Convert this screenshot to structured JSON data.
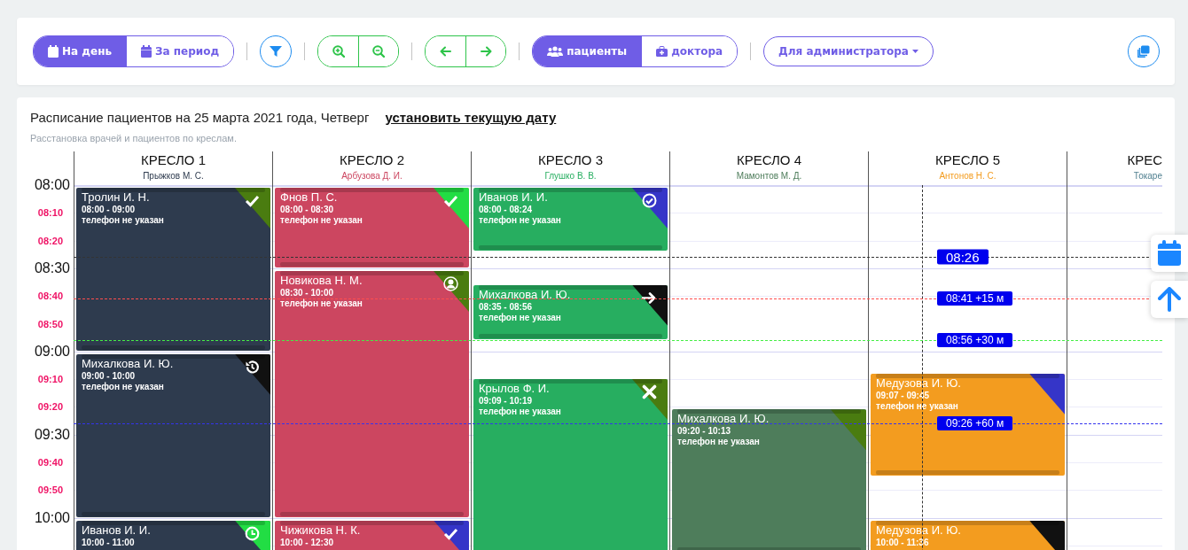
{
  "toolbar": {
    "view_toggle": [
      {
        "label": "На день",
        "selected": true
      },
      {
        "label": "За период",
        "selected": false
      }
    ],
    "mode_toggle": [
      {
        "label": "пациенты",
        "selected": true
      },
      {
        "label": "доктора",
        "selected": false
      }
    ],
    "role_dropdown": {
      "label": "Для администратора"
    }
  },
  "schedule": {
    "title": "Расписание пациентов на 25 марта 2021 года, Четверг",
    "set_today_link": "установить текущую дату",
    "subtitle": "Расстановка врачей и пациентов по креслам."
  },
  "time_labels": [
    {
      "label": "08:00",
      "kind": "hour"
    },
    {
      "label": "08:10",
      "kind": "minute"
    },
    {
      "label": "08:20",
      "kind": "minute"
    },
    {
      "label": "08:30",
      "kind": "hour"
    },
    {
      "label": "08:40",
      "kind": "minute"
    },
    {
      "label": "08:50",
      "kind": "minute"
    },
    {
      "label": "09:00",
      "kind": "hour"
    },
    {
      "label": "09:10",
      "kind": "minute"
    },
    {
      "label": "09:20",
      "kind": "minute"
    },
    {
      "label": "09:30",
      "kind": "hour"
    },
    {
      "label": "09:40",
      "kind": "minute"
    },
    {
      "label": "09:50",
      "kind": "minute"
    },
    {
      "label": "10:00",
      "kind": "hour"
    }
  ],
  "chairs": [
    {
      "name": "КРЕСЛО 1",
      "doctor": "Прыжков М. С.",
      "color": "#2e3b4e",
      "appointments": [
        {
          "patient": "Тролин И. Н.",
          "time": "08:00 - 09:00",
          "phone": "телефон не указан",
          "kind": "check",
          "color": "#4a7c10"
        },
        {
          "patient": "Михалкова И. Ю.",
          "time": "09:00 - 10:00",
          "phone": "телефон не указан",
          "kind": "history",
          "color": "#111111"
        },
        {
          "patient": "Иванов И. И.",
          "time": "10:00 - 11:00",
          "kind": "clock",
          "color": "#22dd44"
        }
      ]
    },
    {
      "name": "КРЕСЛО 2",
      "doctor": "Арбузова Д. И.",
      "color": "#cc4660",
      "appointments": [
        {
          "patient": "Фнов П. С.",
          "time": "08:00 - 08:30",
          "phone": "телефон не указан",
          "kind": "check",
          "color": "#22dd44"
        },
        {
          "patient": "Новикова Н. М.",
          "time": "08:30 - 10:00",
          "phone": "телефон не указан",
          "kind": "user",
          "color": "#4a7c10"
        },
        {
          "patient": "Чижикова Н. К.",
          "time": "10:00 - 12:30",
          "kind": "check",
          "color": "#3535c8"
        }
      ]
    },
    {
      "name": "КРЕСЛО 3",
      "doctor": "Глушко В. В.",
      "color": "#27ae60",
      "appointments": [
        {
          "patient": "Иванов И. И.",
          "time": "08:00 - 08:24",
          "phone": "телефон не указан",
          "kind": "check-circle",
          "color": "#3535c8"
        },
        {
          "patient": "Михалкова И. Ю.",
          "time": "08:35 - 08:56",
          "phone": "телефон не указан",
          "kind": "arrow",
          "color": "#111111"
        },
        {
          "patient": "Крылов Ф. И.",
          "time": "09:09 - 10:19",
          "phone": "телефон не указан",
          "kind": "cross",
          "color": "#4a7c10"
        }
      ]
    },
    {
      "name": "КРЕСЛО 4",
      "doctor": "Мамонтов М. Д.",
      "color": "#4e7d5b",
      "appointments": [
        {
          "patient": "Михалкова И. Ю.",
          "time": "09:20 - 10:13",
          "phone": "телефон не указан",
          "kind": "plain",
          "color": "#4a7c10"
        }
      ]
    },
    {
      "name": "КРЕСЛО 5",
      "doctor": "Антонов Н. С.",
      "color": "#f39c1f",
      "appointments": [
        {
          "patient": "Медузова И. Ю.",
          "time": "09:07 - 09:45",
          "phone": "телефон не указан",
          "kind": "plain",
          "color": "#3535c8"
        },
        {
          "patient": "Медузова И. Ю.",
          "time": "10:00 - 11:36",
          "kind": "plain",
          "color": "#111111"
        }
      ]
    },
    {
      "name": "КРЕС",
      "doctor": "Токаре",
      "color": "#4f7f8f"
    }
  ],
  "time_markers": [
    {
      "label": "08:26",
      "kind": "now",
      "color": "#333333"
    },
    {
      "label": "08:41 +15 м",
      "kind": "offset",
      "color": "#ff4d4d"
    },
    {
      "label": "08:56 +30 м",
      "kind": "offset",
      "color": "#44ee44"
    },
    {
      "label": "09:26 +60 м",
      "kind": "offset",
      "color": "#3333ee"
    }
  ]
}
